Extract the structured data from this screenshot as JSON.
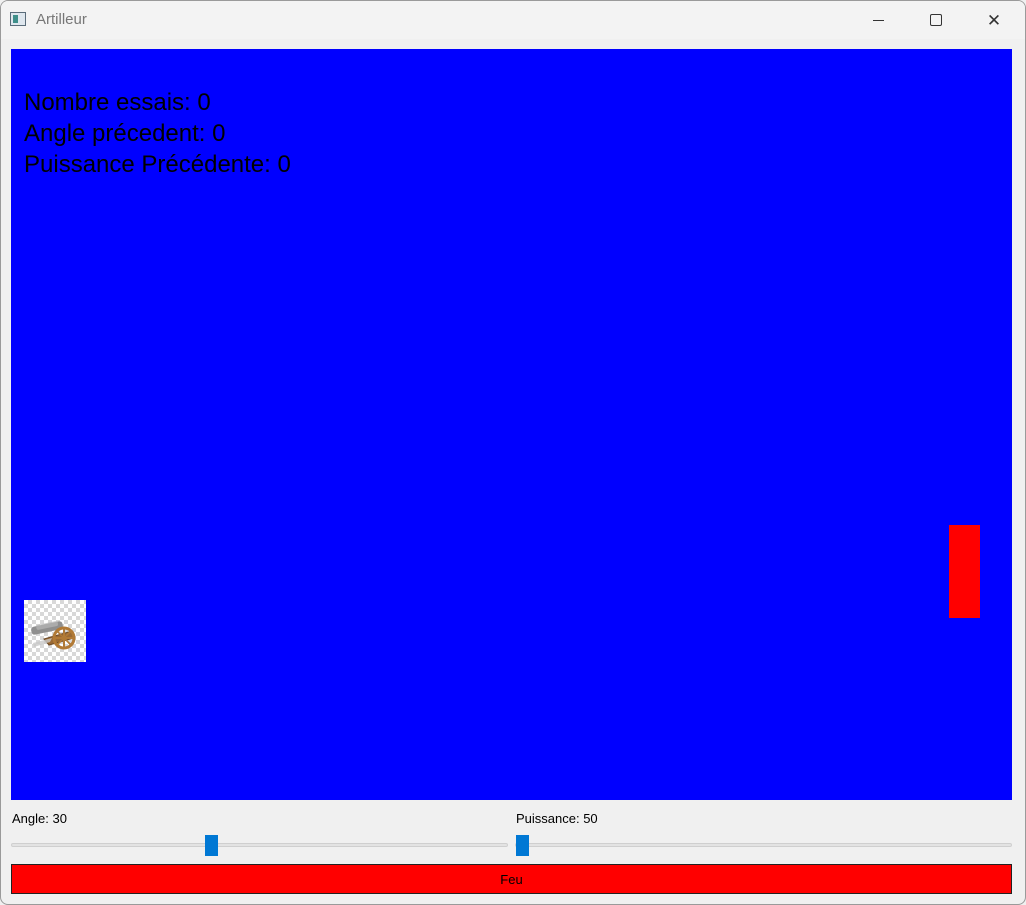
{
  "window": {
    "title": "Artilleur"
  },
  "stats": {
    "attempts": "Nombre essais: 0",
    "previous_angle": "Angle précedent: 0",
    "previous_power": "Puissance Précédente: 0"
  },
  "controls": {
    "angle_label": "Angle: 30",
    "angle_value": 30,
    "power_label": "Puissance: 50",
    "power_value": 50,
    "fire_label": "Feu"
  },
  "colors": {
    "game_background": "#0000ff",
    "target": "#ff0000",
    "fire_button": "#ff0000",
    "slider_handle": "#0078d4"
  },
  "icons": {
    "window_icon": "app-window-icon",
    "cannon": "cannon-icon",
    "minimize": "minimize-icon",
    "maximize": "maximize-icon",
    "close": "close-icon"
  }
}
